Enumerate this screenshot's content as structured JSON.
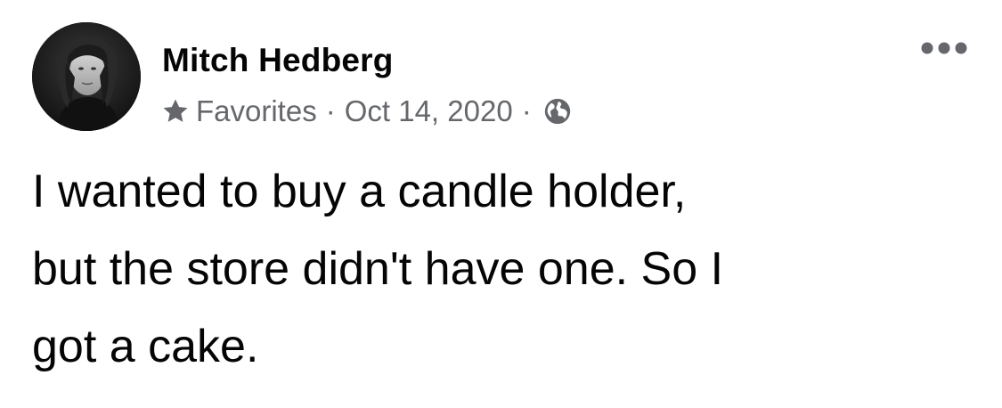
{
  "post": {
    "author": "Mitch Hedberg",
    "audience_icon": "star-icon",
    "audience_label": "Favorites",
    "separator": "·",
    "date": "Oct 14, 2020",
    "privacy_icon": "globe-icon",
    "more_icon": "more-options-icon",
    "text": "I wanted to buy a candle holder,\nbut the store didn't have one. So I\ngot a cake."
  },
  "colors": {
    "text_primary": "#050505",
    "text_secondary": "#65676b",
    "background": "#ffffff"
  }
}
